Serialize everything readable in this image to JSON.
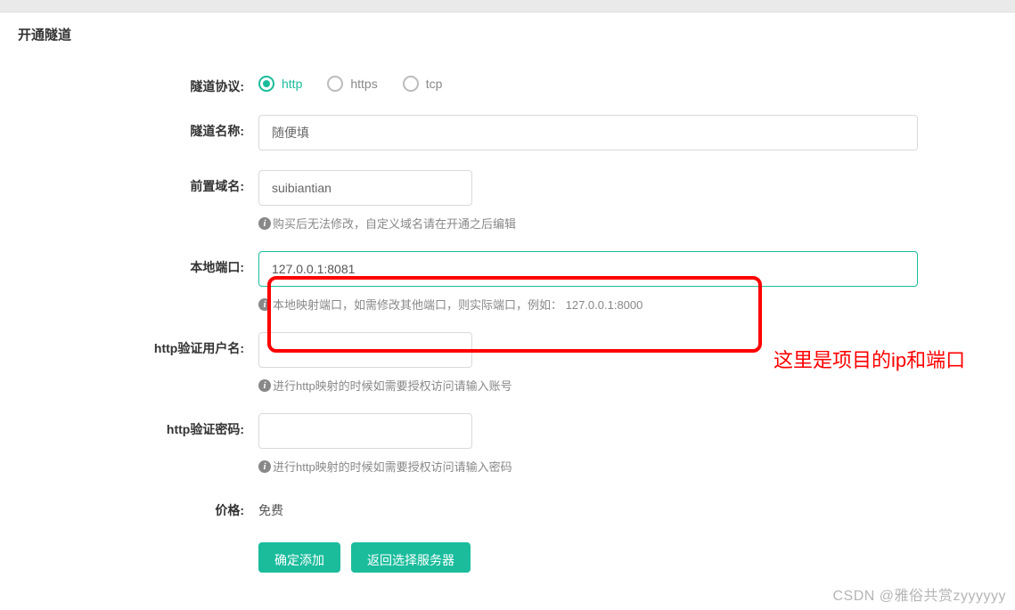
{
  "title": "开通隧道",
  "labels": {
    "protocol": "隧道协议:",
    "name": "隧道名称:",
    "domain": "前置域名:",
    "port": "本地端口:",
    "user": "http验证用户名:",
    "pass": "http验证密码:",
    "price": "价格:"
  },
  "protocol": {
    "options": [
      "http",
      "https",
      "tcp"
    ],
    "selected": "http"
  },
  "values": {
    "name": "随便填",
    "domain": "suibiantian",
    "port": "127.0.0.1:8081",
    "user": "",
    "pass": "",
    "price": "免费"
  },
  "hints": {
    "domain": "购买后无法修改，自定义域名请在开通之后编辑",
    "port": "本地映射端口，如需修改其他端口，则实际端口，例如： 127.0.0.1:8000",
    "user": "进行http映射的时候如需要授权访问请输入账号",
    "pass": "进行http映射的时候如需要授权访问请输入密码"
  },
  "buttons": {
    "confirm": "确定添加",
    "back": "返回选择服务器"
  },
  "annotation": "这里是项目的ip和端口",
  "watermark": "CSDN @雅俗共赏zyyyyyy",
  "colors": {
    "accent": "#1abc9c",
    "highlight": "#ff0000"
  }
}
